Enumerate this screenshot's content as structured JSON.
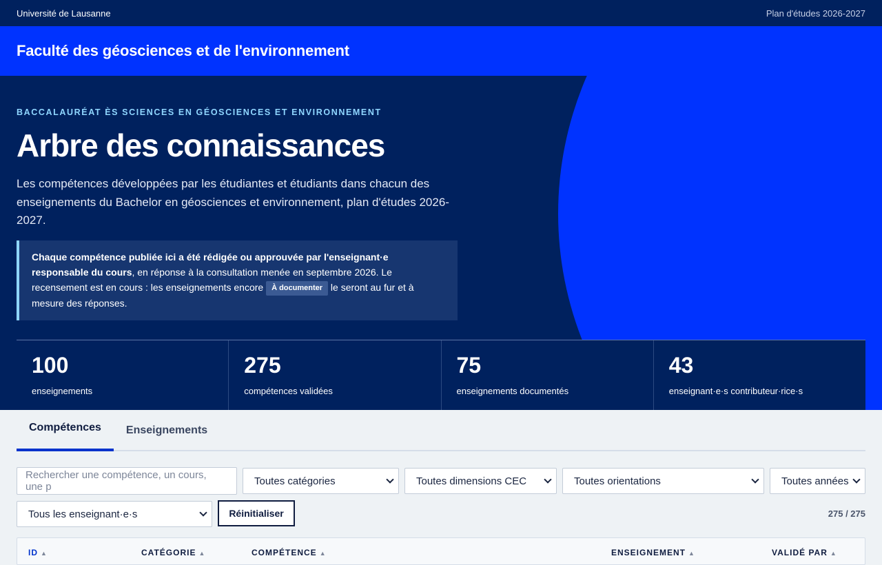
{
  "topbar": {
    "university": "Université de Lausanne",
    "plan": "Plan d'études 2026-2027"
  },
  "faculty": {
    "name": "Faculté des géosciences et de l'environnement"
  },
  "hero": {
    "kicker": "BACCALAURÉAT ÈS SCIENCES EN GÉOSCIENCES ET ENVIRONNEMENT",
    "title": "Arbre des connaissances",
    "lead": "Les compétences développées par les étudiantes et étudiants dans chacun des enseignements du Bachelor en géosciences et environnement, plan d'études 2026-2027.",
    "notice_bold": "Chaque compétence publiée ici a été rédigée ou approuvée par l'enseignant·e responsable du cours",
    "notice_text1": ", en réponse à la consultation menée en septembre 2026. Le recensement est en cours : les enseignements encore ",
    "notice_tag": "À documenter",
    "notice_text2": " le seront au fur et à mesure des réponses."
  },
  "stats": [
    {
      "value": "100",
      "label": "enseignements"
    },
    {
      "value": "275",
      "label": "compétences validées"
    },
    {
      "value": "75",
      "label": "enseignements documentés"
    },
    {
      "value": "43",
      "label": "enseignant·e·s contributeur·rice·s"
    }
  ],
  "tabs": [
    {
      "label": "Compétences",
      "active": true
    },
    {
      "label": "Enseignements",
      "active": false
    }
  ],
  "filters": {
    "search_placeholder": "Rechercher une compétence, un cours, une p",
    "category": "Toutes catégories",
    "cec": "Toutes dimensions CEC",
    "orientation": "Toutes orientations",
    "year": "Toutes années",
    "teacher": "Tous les enseignant·e·s",
    "reset_label": "Réinitialiser",
    "count": "275 / 275"
  },
  "table": {
    "columns": [
      "ID",
      "CATÉGORIE",
      "COMPÉTENCE",
      "ENSEIGNEMENT",
      "VALIDÉ PAR"
    ]
  },
  "colors": {
    "navy": "#00215e",
    "brand_blue": "#0033ff",
    "accent_cyan": "#8fd6ff"
  }
}
